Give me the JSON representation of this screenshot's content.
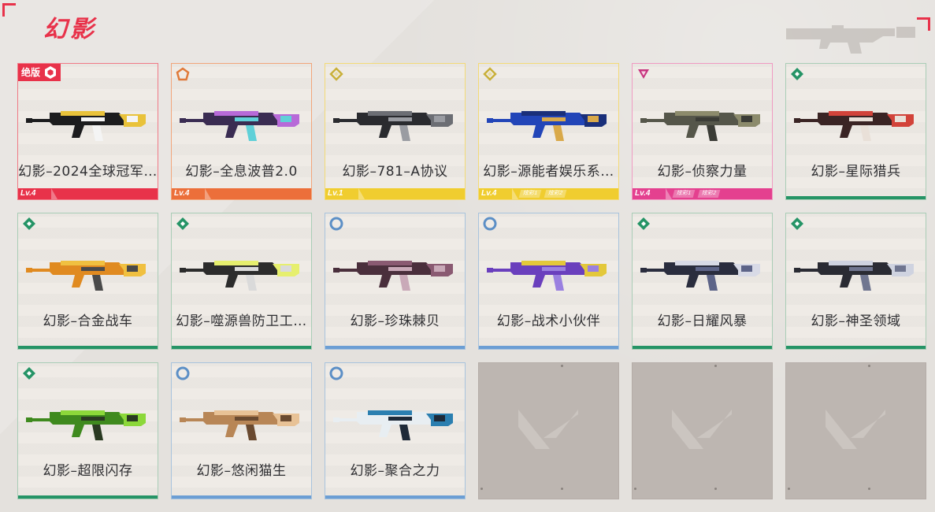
{
  "page": {
    "title": "幻影",
    "accent_color": "#e8324a"
  },
  "items": [
    {
      "name": "幻影–2024全球冠军…",
      "rarity": "red",
      "tier_icon": "exclusive-gem-icon",
      "badge": "绝版",
      "level": "Lv.4",
      "sub_tags": [],
      "gun": {
        "body": "#1c1c1e",
        "accent": "#e9c23a",
        "accent2": "#f4f4f4"
      }
    },
    {
      "name": "幻影–全息波普2.0",
      "rarity": "orange",
      "tier_icon": "pentagon-tier-icon",
      "badge": "",
      "level": "Lv.4",
      "sub_tags": [],
      "gun": {
        "body": "#3a2c52",
        "accent": "#b76ad8",
        "accent2": "#5fd0d8"
      }
    },
    {
      "name": "幻影–781–A协议",
      "rarity": "yellow",
      "tier_icon": "diamond-tier-icon",
      "badge": "",
      "level": "Lv.1",
      "sub_tags": [],
      "gun": {
        "body": "#2a2b2f",
        "accent": "#6c6e74",
        "accent2": "#9a9ca2"
      }
    },
    {
      "name": "幻影–源能者娱乐系…",
      "rarity": "yellow",
      "tier_icon": "diamond-tier-icon",
      "badge": "",
      "level": "Lv.4",
      "sub_tags": [
        "炫彩1",
        "炫彩2"
      ],
      "gun": {
        "body": "#2245b8",
        "accent": "#1a2f7a",
        "accent2": "#d9a94a"
      }
    },
    {
      "name": "幻影–侦察力量",
      "rarity": "pink",
      "tier_icon": "triangle-tier-icon",
      "badge": "",
      "level": "Lv.4",
      "sub_tags": [
        "炫彩1",
        "炫彩2"
      ],
      "gun": {
        "body": "#55564a",
        "accent": "#8c8b6c",
        "accent2": "#3b3c36"
      }
    },
    {
      "name": "幻影–星际猎兵",
      "rarity": "green",
      "tier_icon": "green-gem-icon",
      "badge": "",
      "level": "",
      "sub_tags": [],
      "gun": {
        "body": "#3a2424",
        "accent": "#d2433a",
        "accent2": "#e9e0d8"
      }
    },
    {
      "name": "幻影–合金战车",
      "rarity": "green",
      "tier_icon": "green-gem-icon",
      "badge": "",
      "level": "",
      "sub_tags": [],
      "gun": {
        "body": "#e08a20",
        "accent": "#f0c040",
        "accent2": "#4a4a4a"
      }
    },
    {
      "name": "幻影–噬源兽防卫工…",
      "rarity": "green",
      "tier_icon": "green-gem-icon",
      "badge": "",
      "level": "",
      "sub_tags": [],
      "gun": {
        "body": "#2c2c2c",
        "accent": "#e6ef6e",
        "accent2": "#dadada"
      }
    },
    {
      "name": "幻影–珍珠棘贝",
      "rarity": "blue",
      "tier_icon": "blue-ring-icon",
      "badge": "",
      "level": "",
      "sub_tags": [],
      "gun": {
        "body": "#4a2f3c",
        "accent": "#8a5a72",
        "accent2": "#c9a9b8"
      }
    },
    {
      "name": "幻影–战术小伙伴",
      "rarity": "blue",
      "tier_icon": "blue-ring-icon",
      "badge": "",
      "level": "",
      "sub_tags": [],
      "gun": {
        "body": "#6a3fbd",
        "accent": "#e3c83a",
        "accent2": "#9a80e0"
      }
    },
    {
      "name": "幻影–日耀风暴",
      "rarity": "green",
      "tier_icon": "green-gem-icon",
      "badge": "",
      "level": "",
      "sub_tags": [],
      "gun": {
        "body": "#2a2d3e",
        "accent": "#d8dae6",
        "accent2": "#5d6488"
      }
    },
    {
      "name": "幻影–神圣领域",
      "rarity": "green",
      "tier_icon": "green-gem-icon",
      "badge": "",
      "level": "",
      "sub_tags": [],
      "gun": {
        "body": "#2a2b33",
        "accent": "#cfd3e0",
        "accent2": "#707690"
      }
    },
    {
      "name": "幻影–超限闪存",
      "rarity": "green",
      "tier_icon": "green-gem-icon",
      "badge": "",
      "level": "",
      "sub_tags": [],
      "gun": {
        "body": "#3f8a1e",
        "accent": "#8cd83a",
        "accent2": "#2a3a22"
      }
    },
    {
      "name": "幻影–悠闲猫生",
      "rarity": "blue",
      "tier_icon": "blue-ring-icon",
      "badge": "",
      "level": "",
      "sub_tags": [],
      "gun": {
        "body": "#b88656",
        "accent": "#e8c296",
        "accent2": "#6a4a30"
      }
    },
    {
      "name": "幻影–聚合之力",
      "rarity": "blue",
      "tier_icon": "blue-ring-icon",
      "badge": "",
      "level": "",
      "sub_tags": [],
      "gun": {
        "body": "#e8eef2",
        "accent": "#2b7fb0",
        "accent2": "#1e2a38"
      }
    }
  ],
  "empty_slots": 3,
  "rarity_colors": {
    "red": "#e8324a",
    "orange": "#ec6f3a",
    "yellow": "#f0cd2f",
    "pink": "#e4408f",
    "green": "#259466",
    "blue": "#6b9ed4"
  }
}
